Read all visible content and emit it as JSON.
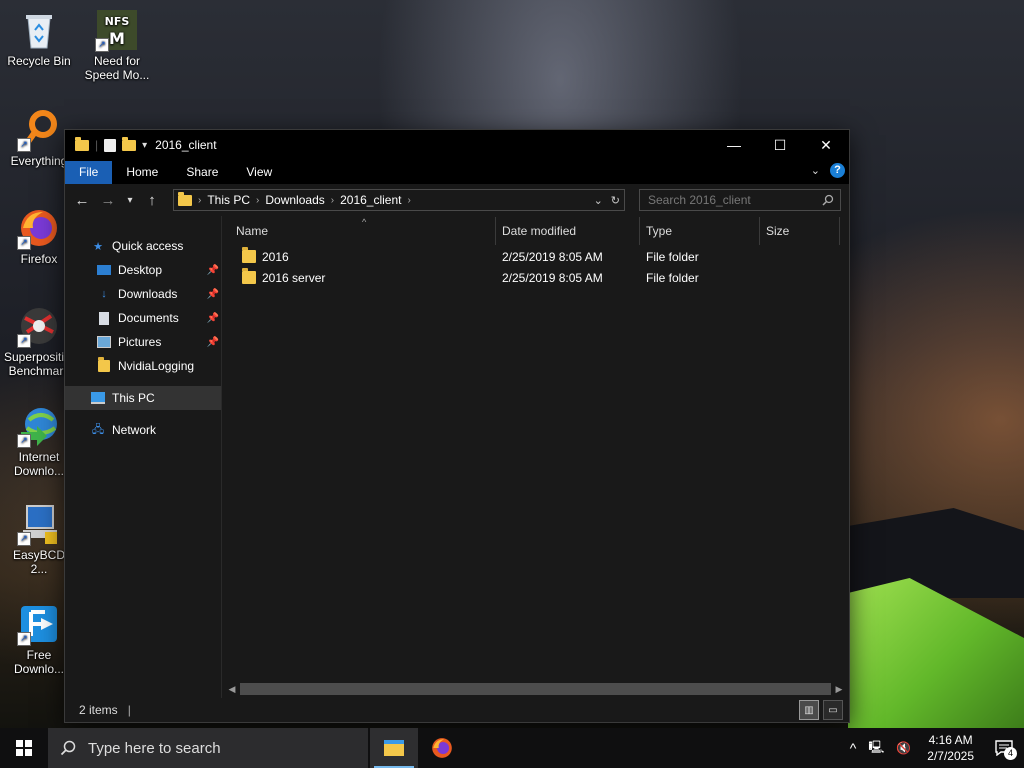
{
  "desktop": {
    "icons": [
      {
        "label": "Recycle Bin"
      },
      {
        "label": "Need for Speed Mo..."
      },
      {
        "label": "Everything"
      },
      {
        "label": "Firefox"
      },
      {
        "label": "Superposition Benchmark"
      },
      {
        "label": "Internet Downlo..."
      },
      {
        "label": "EasyBCD 2..."
      },
      {
        "label": "Free Downlo..."
      }
    ]
  },
  "window": {
    "title": "2016_client",
    "controls": {
      "minimize": "—",
      "maximize": "☐",
      "close": "✕"
    },
    "ribbon_tabs": [
      "File",
      "Home",
      "Share",
      "View"
    ],
    "address": {
      "crumbs": [
        "This PC",
        "Downloads",
        "2016_client"
      ]
    },
    "search": {
      "placeholder": "Search 2016_client"
    },
    "nav": {
      "quick_access": "Quick access",
      "items": [
        "Desktop",
        "Downloads",
        "Documents",
        "Pictures",
        "NvidiaLogging"
      ],
      "this_pc": "This PC",
      "network": "Network"
    },
    "columns": [
      "Name",
      "Date modified",
      "Type",
      "Size"
    ],
    "rows": [
      {
        "name": "2016",
        "date": "2/25/2019 8:05 AM",
        "type": "File folder",
        "size": ""
      },
      {
        "name": "2016 server",
        "date": "2/25/2019 8:05 AM",
        "type": "File folder",
        "size": ""
      }
    ],
    "status": {
      "count": "2 items",
      "separator": "|"
    }
  },
  "taskbar": {
    "search_placeholder": "Type here to search",
    "time": "4:16 AM",
    "date": "2/7/2025",
    "notification_count": "4"
  },
  "colors": {
    "accent": "#1a5fb4",
    "folder": "#f3c74a",
    "window_bg": "#191919"
  }
}
